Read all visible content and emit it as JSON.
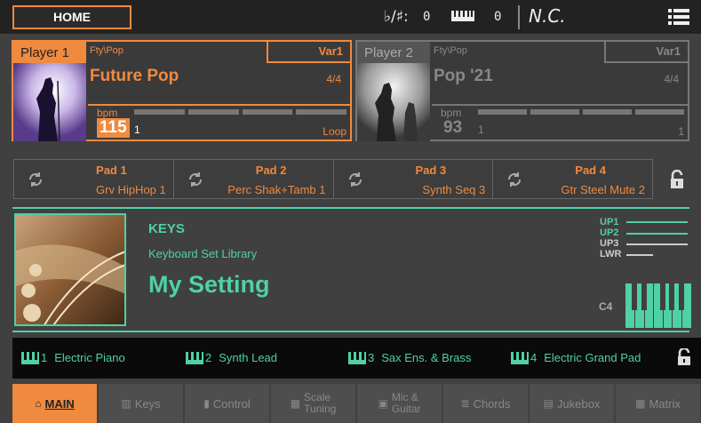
{
  "topbar": {
    "home_label": "HOME",
    "accidental_label": "♭/♯:",
    "accidental_value": "0",
    "keyboard_value": "0",
    "chord": "N.C."
  },
  "players": [
    {
      "tag": "Player 1",
      "category": "Fty\\Pop",
      "variation": "Var1",
      "name": "Future Pop",
      "meter": "4/4",
      "bpm_label": "bpm",
      "tempo": "115",
      "beat": "1",
      "mode": "Loop"
    },
    {
      "tag": "Player 2",
      "category": "Fty\\Pop",
      "variation": "Var1",
      "name": "Pop '21",
      "meter": "4/4",
      "bpm_label": "bpm",
      "tempo": "93",
      "beat": "1",
      "mode": "1"
    }
  ],
  "pads": [
    {
      "num": "Pad 1",
      "sound": "Grv HipHop 1"
    },
    {
      "num": "Pad 2",
      "sound": "Perc Shak+Tamb 1"
    },
    {
      "num": "Pad 3",
      "sound": "Synth Seq 3"
    },
    {
      "num": "Pad 4",
      "sound": "Gtr Steel Mute 2"
    }
  ],
  "keys": {
    "title": "KEYS",
    "library": "Keyboard Set Library",
    "setting": "My Setting",
    "layers": [
      "UP1",
      "UP2",
      "UP3",
      "LWR"
    ],
    "octave": "C4"
  },
  "keyboard_sets": [
    {
      "num": "1",
      "name": "Electric Piano"
    },
    {
      "num": "2",
      "name": "Synth Lead"
    },
    {
      "num": "3",
      "name": "Sax Ens. & Brass"
    },
    {
      "num": "4",
      "name": "Electric Grand Pad"
    }
  ],
  "tabs": [
    {
      "label": "MAIN",
      "icon": "home-icon"
    },
    {
      "label": "Keys",
      "icon": "keys-icon"
    },
    {
      "label": "Control",
      "icon": "control-icon"
    },
    {
      "label1": "Scale",
      "label2": "Tuning",
      "icon": "scale-icon"
    },
    {
      "label1": "Mic &",
      "label2": "Guitar",
      "icon": "mic-icon"
    },
    {
      "label": "Chords",
      "icon": "chords-icon"
    },
    {
      "label": "Jukebox",
      "icon": "jukebox-icon"
    },
    {
      "label": "Matrix",
      "icon": "matrix-icon"
    }
  ],
  "colors": {
    "accent": "#f08a3e",
    "keys": "#4fd1a4",
    "background": "#404040"
  }
}
